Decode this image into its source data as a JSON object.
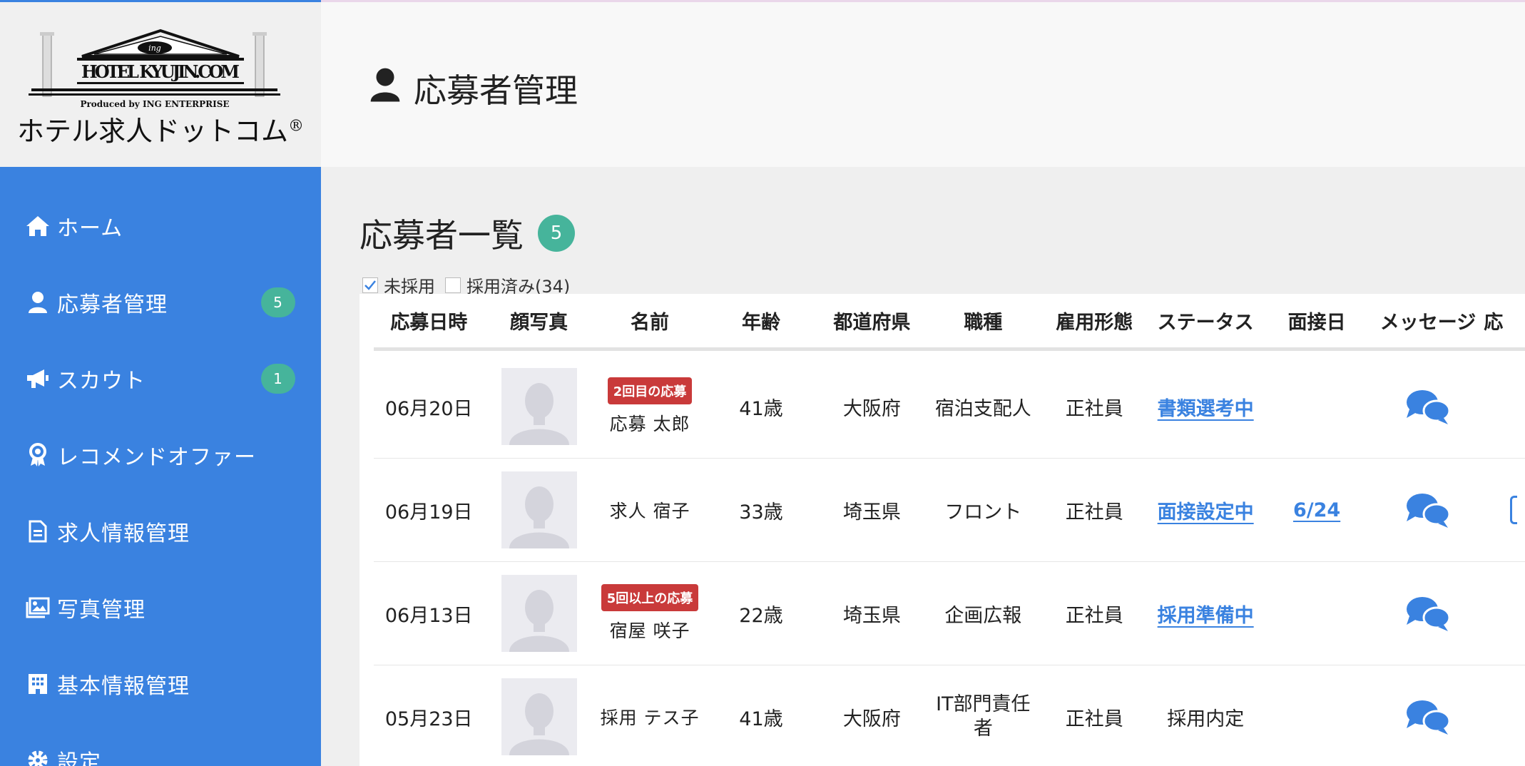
{
  "brand": {
    "logo_en": "HOTEL KYUJIN.COM",
    "logo_ing": "ing",
    "logo_sub": "Produced by ING ENTERPRISE",
    "logo_jp": "ホテル求人ドットコム",
    "logo_reg": "®"
  },
  "header": {
    "title": "応募者管理"
  },
  "sidebar": {
    "items": [
      {
        "label": "ホーム",
        "icon": "home-icon"
      },
      {
        "label": "応募者管理",
        "icon": "user-icon",
        "badge": "5"
      },
      {
        "label": "スカウト",
        "icon": "megaphone-icon",
        "badge": "1"
      },
      {
        "label": "レコメンドオファー",
        "icon": "award-icon"
      },
      {
        "label": "求人情報管理",
        "icon": "document-icon"
      },
      {
        "label": "写真管理",
        "icon": "image-icon"
      },
      {
        "label": "基本情報管理",
        "icon": "building-icon"
      },
      {
        "label": "設定",
        "icon": "gear-icon"
      }
    ]
  },
  "main": {
    "section_title": "応募者一覧",
    "count": "5",
    "filters": [
      {
        "label": "未採用",
        "checked": true
      },
      {
        "label": "採用済み(34)",
        "checked": false
      }
    ],
    "columns": [
      "応募日時",
      "顔写真",
      "名前",
      "年齢",
      "都道府県",
      "職種",
      "雇用形態",
      "ステータス",
      "面接日",
      "メッセージ",
      "応"
    ],
    "rows": [
      {
        "date": "06月20日",
        "tag": "2回目の応募",
        "name": "応募 太郎",
        "age": "41歳",
        "pref": "大阪府",
        "job": "宿泊支配人",
        "emp": "正社員",
        "status": "書類選考中",
        "interview": ""
      },
      {
        "date": "06月19日",
        "tag": "",
        "name": "求人 宿子",
        "age": "33歳",
        "pref": "埼玉県",
        "job": "フロント",
        "emp": "正社員",
        "status": "面接設定中",
        "interview": "6/24"
      },
      {
        "date": "06月13日",
        "tag": "5回以上の応募",
        "name": "宿屋 咲子",
        "age": "22歳",
        "pref": "埼玉県",
        "job": "企画広報",
        "emp": "正社員",
        "status": "採用準備中",
        "interview": ""
      },
      {
        "date": "05月23日",
        "tag": "",
        "name": "採用 テス子",
        "age": "41歳",
        "pref": "大阪府",
        "job": "IT部門責任者",
        "emp": "正社員",
        "status": "採用内定",
        "interview": ""
      }
    ]
  },
  "colors": {
    "sidebar": "#3a82e0",
    "badge": "#46b49b",
    "tag": "#c93a3a",
    "link": "#3a82e0"
  }
}
